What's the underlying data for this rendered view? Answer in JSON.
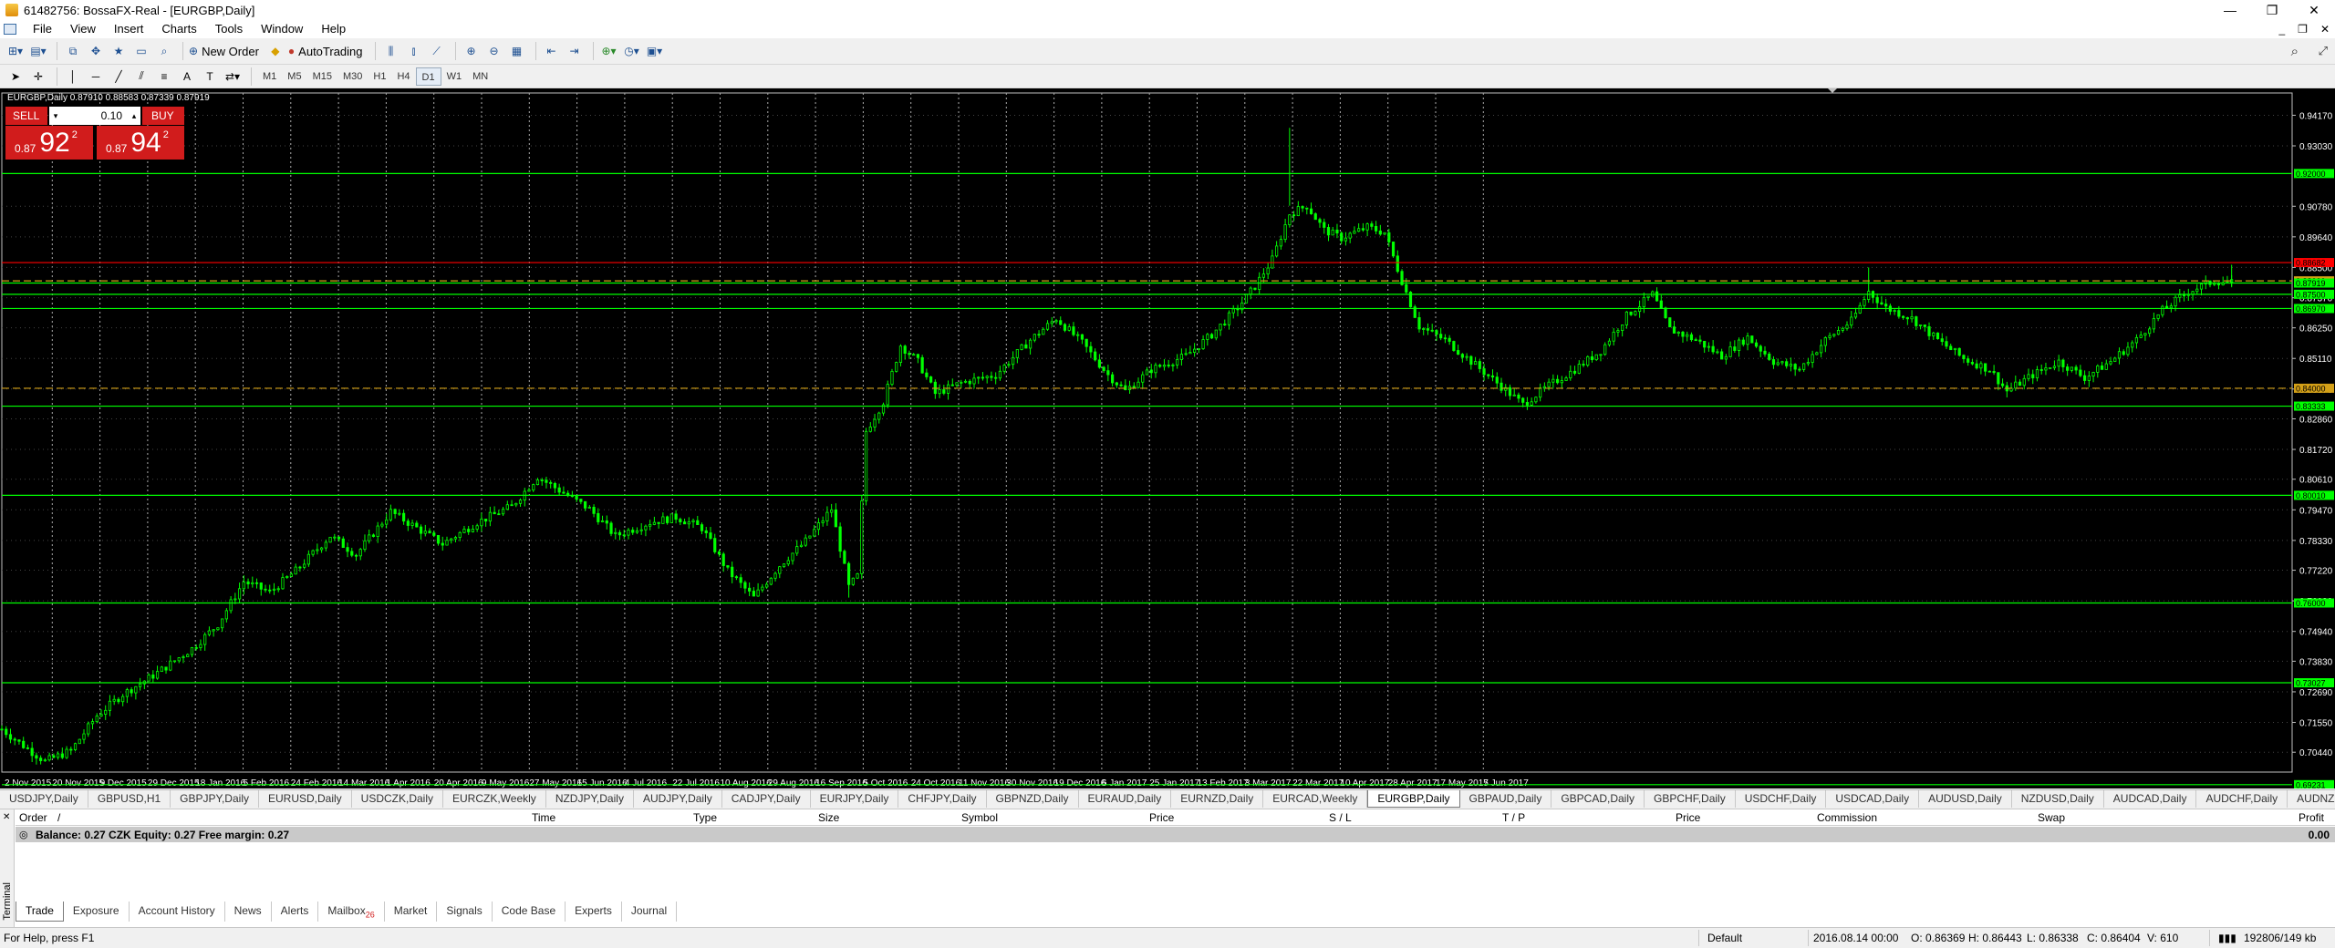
{
  "window": {
    "title": "61482756: BossaFX-Real - [EURGBP,Daily]",
    "minimize": "—",
    "restore": "❐",
    "close": "✕"
  },
  "menu": [
    "File",
    "Insert",
    "Charts",
    "Tools",
    "Window",
    "Help"
  ],
  "menu_view": "View",
  "toolbar": {
    "new_order": "New Order",
    "autotrading": "AutoTrading",
    "timeframes": [
      "M1",
      "M5",
      "M15",
      "M30",
      "H1",
      "H4",
      "D1",
      "W1",
      "MN"
    ],
    "active_timeframe": "D1",
    "text_tool": "A"
  },
  "symbol_info": "EURGBP,Daily  0.87910 0.88583 0.87339 0.87919",
  "trade_panel": {
    "sell_label": "SELL",
    "buy_label": "BUY",
    "lot": "0.10",
    "sell_small": "0.87",
    "sell_big": "92",
    "sell_sup": "2",
    "buy_small": "0.87",
    "buy_big": "94",
    "buy_sup": "2"
  },
  "chart_data": {
    "type": "candlestick",
    "symbol": "EURGBP",
    "timeframe": "Daily",
    "ylim": [
      0.697,
      0.95
    ],
    "y_ticks": [
      0.9417,
      0.9303,
      0.9078,
      0.8964,
      0.885,
      0.8737,
      0.8625,
      0.8511,
      0.8397,
      0.8286,
      0.8172,
      0.8061,
      0.7947,
      0.7833,
      0.7722,
      0.7608,
      0.7494,
      0.7383,
      0.7269,
      0.7155,
      0.7044,
      0.693
    ],
    "x_labels": [
      "2 Nov 2015",
      "20 Nov 2015",
      "9 Dec 2015",
      "29 Dec 2015",
      "18 Jan 2016",
      "5 Feb 2016",
      "24 Feb 2016",
      "14 Mar 2016",
      "1 Apr 2016",
      "20 Apr 2016",
      "9 May 2016",
      "27 May 2016",
      "15 Jun 2016",
      "4 Jul 2016",
      "22 Jul 2016",
      "10 Aug 2016",
      "29 Aug 2016",
      "16 Sep 2016",
      "5 Oct 2016",
      "24 Oct 2016",
      "11 Nov 2016",
      "30 Nov 2016",
      "19 Dec 2016",
      "6 Jan 2017",
      "25 Jan 2017",
      "13 Feb 2017",
      "3 Mar 2017",
      "22 Mar 2017",
      "10 Apr 2017",
      "28 Apr 2017",
      "17 May 2017",
      "5 Jun 2017"
    ],
    "price_path": [
      [
        0,
        0.713
      ],
      [
        4,
        0.708
      ],
      [
        10,
        0.701
      ],
      [
        16,
        0.705
      ],
      [
        22,
        0.718
      ],
      [
        28,
        0.726
      ],
      [
        36,
        0.734
      ],
      [
        44,
        0.743
      ],
      [
        50,
        0.752
      ],
      [
        56,
        0.768
      ],
      [
        62,
        0.764
      ],
      [
        68,
        0.772
      ],
      [
        76,
        0.785
      ],
      [
        82,
        0.778
      ],
      [
        90,
        0.794
      ],
      [
        96,
        0.788
      ],
      [
        102,
        0.782
      ],
      [
        110,
        0.79
      ],
      [
        118,
        0.796
      ],
      [
        124,
        0.807
      ],
      [
        130,
        0.801
      ],
      [
        136,
        0.795
      ],
      [
        142,
        0.785
      ],
      [
        150,
        0.79
      ],
      [
        156,
        0.792
      ],
      [
        162,
        0.788
      ],
      [
        168,
        0.772
      ],
      [
        174,
        0.762
      ],
      [
        180,
        0.774
      ],
      [
        186,
        0.783
      ],
      [
        192,
        0.795
      ],
      [
        196,
        0.766
      ],
      [
        198,
        0.77
      ],
      [
        200,
        0.824
      ],
      [
        204,
        0.835
      ],
      [
        208,
        0.856
      ],
      [
        212,
        0.85
      ],
      [
        216,
        0.838
      ],
      [
        222,
        0.842
      ],
      [
        230,
        0.845
      ],
      [
        238,
        0.858
      ],
      [
        244,
        0.866
      ],
      [
        250,
        0.857
      ],
      [
        256,
        0.845
      ],
      [
        260,
        0.839
      ],
      [
        266,
        0.847
      ],
      [
        274,
        0.852
      ],
      [
        280,
        0.86
      ],
      [
        286,
        0.87
      ],
      [
        290,
        0.878
      ],
      [
        294,
        0.888
      ],
      [
        298,
        0.905
      ],
      [
        302,
        0.908
      ],
      [
        306,
        0.899
      ],
      [
        310,
        0.896
      ],
      [
        316,
        0.9
      ],
      [
        320,
        0.898
      ],
      [
        324,
        0.88
      ],
      [
        328,
        0.863
      ],
      [
        334,
        0.858
      ],
      [
        340,
        0.85
      ],
      [
        346,
        0.842
      ],
      [
        352,
        0.834
      ],
      [
        358,
        0.841
      ],
      [
        364,
        0.847
      ],
      [
        370,
        0.854
      ],
      [
        376,
        0.867
      ],
      [
        382,
        0.875
      ],
      [
        386,
        0.862
      ],
      [
        392,
        0.858
      ],
      [
        398,
        0.852
      ],
      [
        404,
        0.859
      ],
      [
        410,
        0.85
      ],
      [
        416,
        0.847
      ],
      [
        422,
        0.858
      ],
      [
        428,
        0.865
      ],
      [
        432,
        0.876
      ],
      [
        436,
        0.87
      ],
      [
        442,
        0.866
      ],
      [
        448,
        0.858
      ],
      [
        454,
        0.851
      ],
      [
        460,
        0.847
      ],
      [
        464,
        0.839
      ],
      [
        470,
        0.845
      ],
      [
        476,
        0.85
      ],
      [
        482,
        0.844
      ],
      [
        488,
        0.85
      ],
      [
        494,
        0.858
      ],
      [
        500,
        0.869
      ],
      [
        506,
        0.876
      ],
      [
        512,
        0.88
      ],
      [
        516,
        0.8792
      ]
    ],
    "price_path_x_note": "trading days from 2 Nov 2015",
    "horizontal_lines": [
      {
        "price": 0.92,
        "color": "#00ff00",
        "style": "solid",
        "label": "0.92000"
      },
      {
        "price": 0.88682,
        "color": "#ff0000",
        "style": "solid",
        "label": "0.88682"
      },
      {
        "price": 0.88,
        "color": "#d4a017",
        "style": "dashed",
        "label": "0.88000"
      },
      {
        "price": 0.87919,
        "color": "#00ff00",
        "style": "solid",
        "label": "0.87919"
      },
      {
        "price": 0.875,
        "color": "#00ff00",
        "style": "solid",
        "label": "0.87500"
      },
      {
        "price": 0.8697,
        "color": "#00ff00",
        "style": "solid",
        "label": "0.86970"
      },
      {
        "price": 0.84,
        "color": "#d4a017",
        "style": "dashed",
        "label": "0.84000"
      },
      {
        "price": 0.83333,
        "color": "#00ff00",
        "style": "solid",
        "label": "0.83333"
      },
      {
        "price": 0.8001,
        "color": "#00ff00",
        "style": "solid",
        "label": "0.80010"
      },
      {
        "price": 0.76,
        "color": "#00ff00",
        "style": "solid",
        "label": "0.76000"
      },
      {
        "price": 0.73027,
        "color": "#00ff00",
        "style": "solid",
        "label": "0.73027"
      },
      {
        "price": 0.69231,
        "color": "#00ff00",
        "style": "solid",
        "label": "0.69231"
      }
    ],
    "grid": true,
    "bull_color": "#00ff00",
    "bear_color": "#00ff00",
    "background": "#000000"
  },
  "chart_tabs": [
    "USDJPY,Daily",
    "GBPUSD,H1",
    "GBPJPY,Daily",
    "EURUSD,Daily",
    "USDCZK,Daily",
    "EURCZK,Weekly",
    "NZDJPY,Daily",
    "AUDJPY,Daily",
    "CADJPY,Daily",
    "EURJPY,Daily",
    "CHFJPY,Daily",
    "GBPNZD,Daily",
    "EURAUD,Daily",
    "EURNZD,Daily",
    "EURCAD,Weekly",
    "EURGBP,Daily",
    "GBPAUD,Daily",
    "GBPCAD,Daily",
    "GBPCHF,Daily",
    "USDCHF,Daily",
    "USDCAD,Daily",
    "AUDUSD,Daily",
    "NZDUSD,Daily",
    "AUDCAD,Daily",
    "AUDCHF,Daily",
    "AUDNZD,Weekly"
  ],
  "active_chart_tab": "EURGBP,Daily",
  "terminal": {
    "side_label": "Terminal",
    "columns": [
      "Order",
      "/",
      "Time",
      "Type",
      "Size",
      "Symbol",
      "Price",
      "S / L",
      "T / P",
      "Price",
      "Commission",
      "Swap",
      "Profit"
    ],
    "balance_text": "Balance: 0.27 CZK  Equity: 0.27  Free margin: 0.27",
    "profit": "0.00",
    "tabs": [
      "Trade",
      "Exposure",
      "Account History",
      "News",
      "Alerts",
      "Mailbox",
      "Market",
      "Signals",
      "Code Base",
      "Experts",
      "Journal"
    ],
    "mailbox_badge": "26",
    "active_tab": "Trade"
  },
  "status": {
    "help": "For Help, press F1",
    "profile": "Default",
    "datetime": "2016.08.14 00:00",
    "open": "O: 0.86369",
    "high": "H: 0.86443",
    "low": "L: 0.86338",
    "close": "C: 0.86404",
    "volume": "V: 610",
    "traffic": "192806/149 kb"
  }
}
